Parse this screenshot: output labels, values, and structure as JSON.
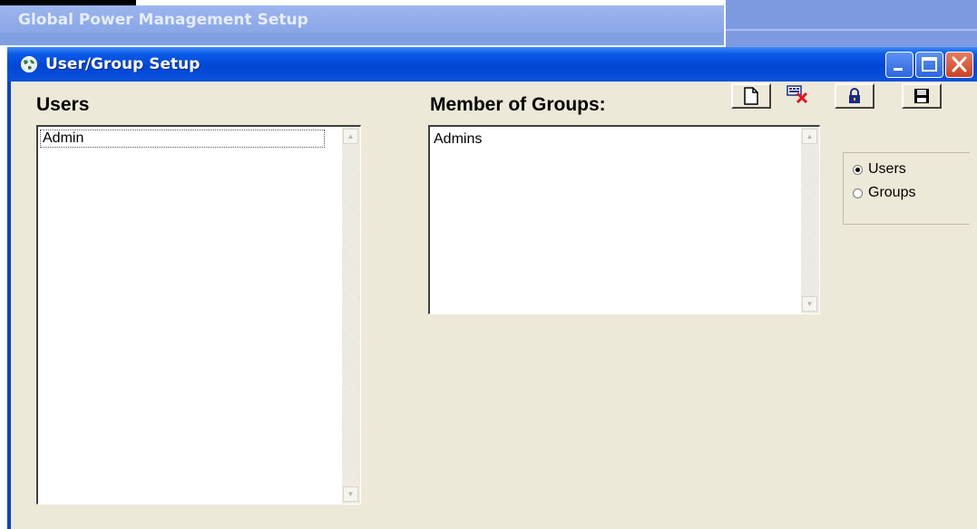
{
  "background_window": {
    "title": "Global Power Management Setup"
  },
  "window": {
    "title": "User/Group Setup",
    "title_icon": "globe-icon",
    "controls": [
      "minimize-icon",
      "maximize-icon",
      "close-icon"
    ]
  },
  "toolbar": {
    "buttons": [
      {
        "icon": "new-document-icon"
      },
      {
        "icon": "delete-icon"
      },
      {
        "icon": "lock-icon"
      },
      {
        "icon": "save-disk-icon"
      }
    ]
  },
  "users": {
    "label": "Users",
    "items": [
      "Admin"
    ]
  },
  "groups": {
    "label": "Member of Groups:",
    "items": [
      "Admins"
    ]
  },
  "view_mode": {
    "options": [
      "Users",
      "Groups"
    ],
    "selected": "Users"
  },
  "colors": {
    "titlebar": "#0046d5",
    "window_bg": "#ece9d8",
    "close_button": "#c84226"
  }
}
